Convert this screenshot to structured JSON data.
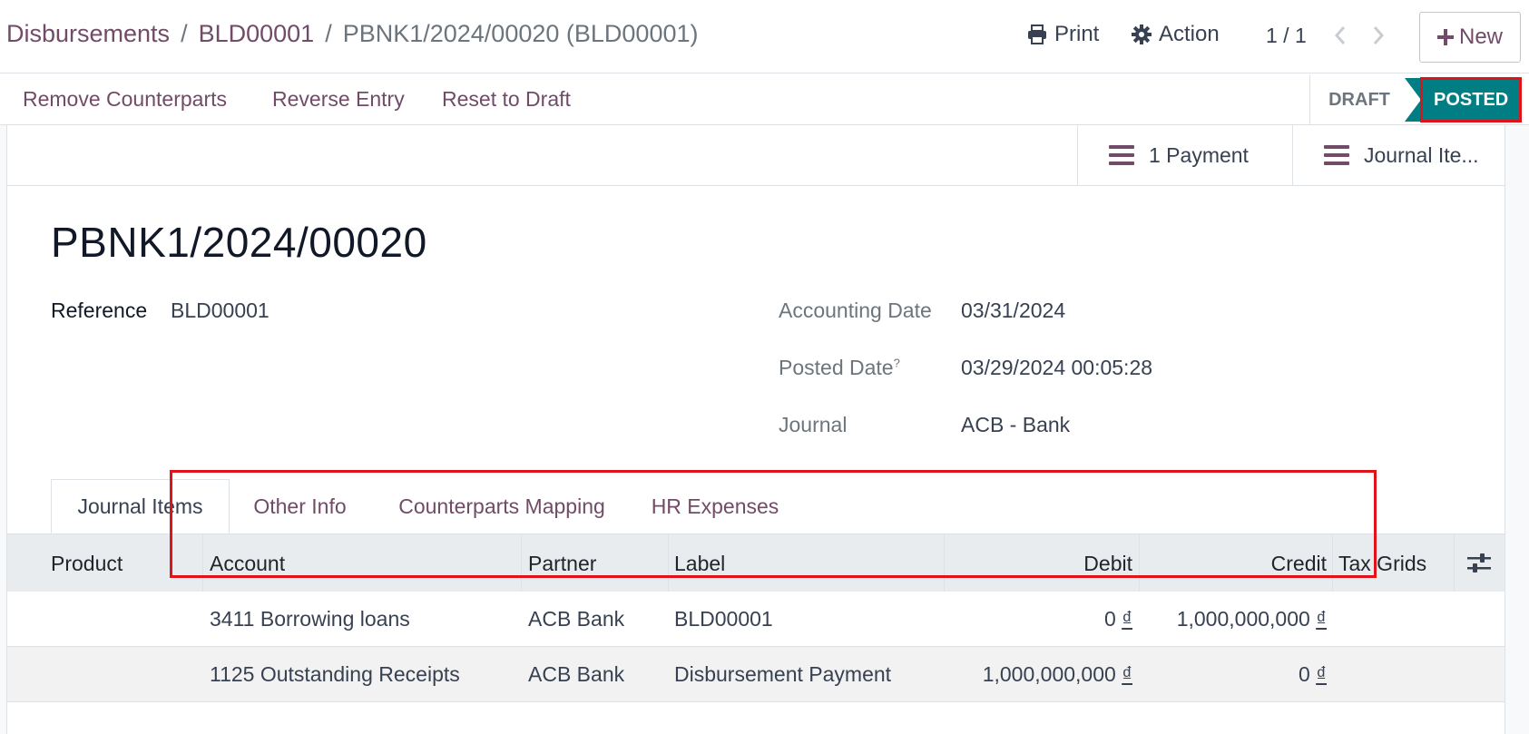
{
  "breadcrumb": {
    "items": [
      "Disbursements",
      "BLD00001"
    ],
    "separator": "/",
    "current": "PBNK1/2024/00020 (BLD00001)"
  },
  "toolbar": {
    "print_label": "Print",
    "action_label": "Action",
    "pager": "1 / 1",
    "new_label": "New"
  },
  "statusbar": {
    "actions": [
      "Remove Counterparts",
      "Reverse Entry",
      "Reset to Draft"
    ],
    "stages": [
      "DRAFT",
      "POSTED"
    ],
    "active_stage": "POSTED"
  },
  "smart_buttons": [
    "1 Payment",
    "Journal Ite..."
  ],
  "record": {
    "title": "PBNK1/2024/00020",
    "reference_label": "Reference",
    "reference": "BLD00001",
    "accounting_date_label": "Accounting Date",
    "accounting_date": "03/31/2024",
    "posted_date_label": "Posted Date",
    "posted_date_help": "?",
    "posted_date": "03/29/2024 00:05:28",
    "journal_label": "Journal",
    "journal": "ACB - Bank"
  },
  "tabs": [
    "Journal Items",
    "Other Info",
    "Counterparts Mapping",
    "HR Expenses"
  ],
  "active_tab": "Journal Items",
  "table": {
    "columns": [
      "Product",
      "Account",
      "Partner",
      "Label",
      "Debit",
      "Credit",
      "Tax Grids"
    ],
    "currency": "₫",
    "rows": [
      {
        "product": "",
        "account": "3411 Borrowing loans",
        "partner": "ACB Bank",
        "label": "BLD00001",
        "debit": "0",
        "credit": "1,000,000,000",
        "tax_grids": ""
      },
      {
        "product": "",
        "account": "1125 Outstanding Receipts",
        "partner": "ACB Bank",
        "label": "Disbursement Payment",
        "debit": "1,000,000,000",
        "credit": "0",
        "tax_grids": ""
      }
    ]
  },
  "colors": {
    "brand": "#714B67",
    "posted": "#017e84",
    "highlight": "#e0131b"
  },
  "icons": [
    "print-icon",
    "gear-icon",
    "chevron-left-icon",
    "chevron-right-icon",
    "plus-icon",
    "list-icon",
    "column-settings-icon"
  ]
}
